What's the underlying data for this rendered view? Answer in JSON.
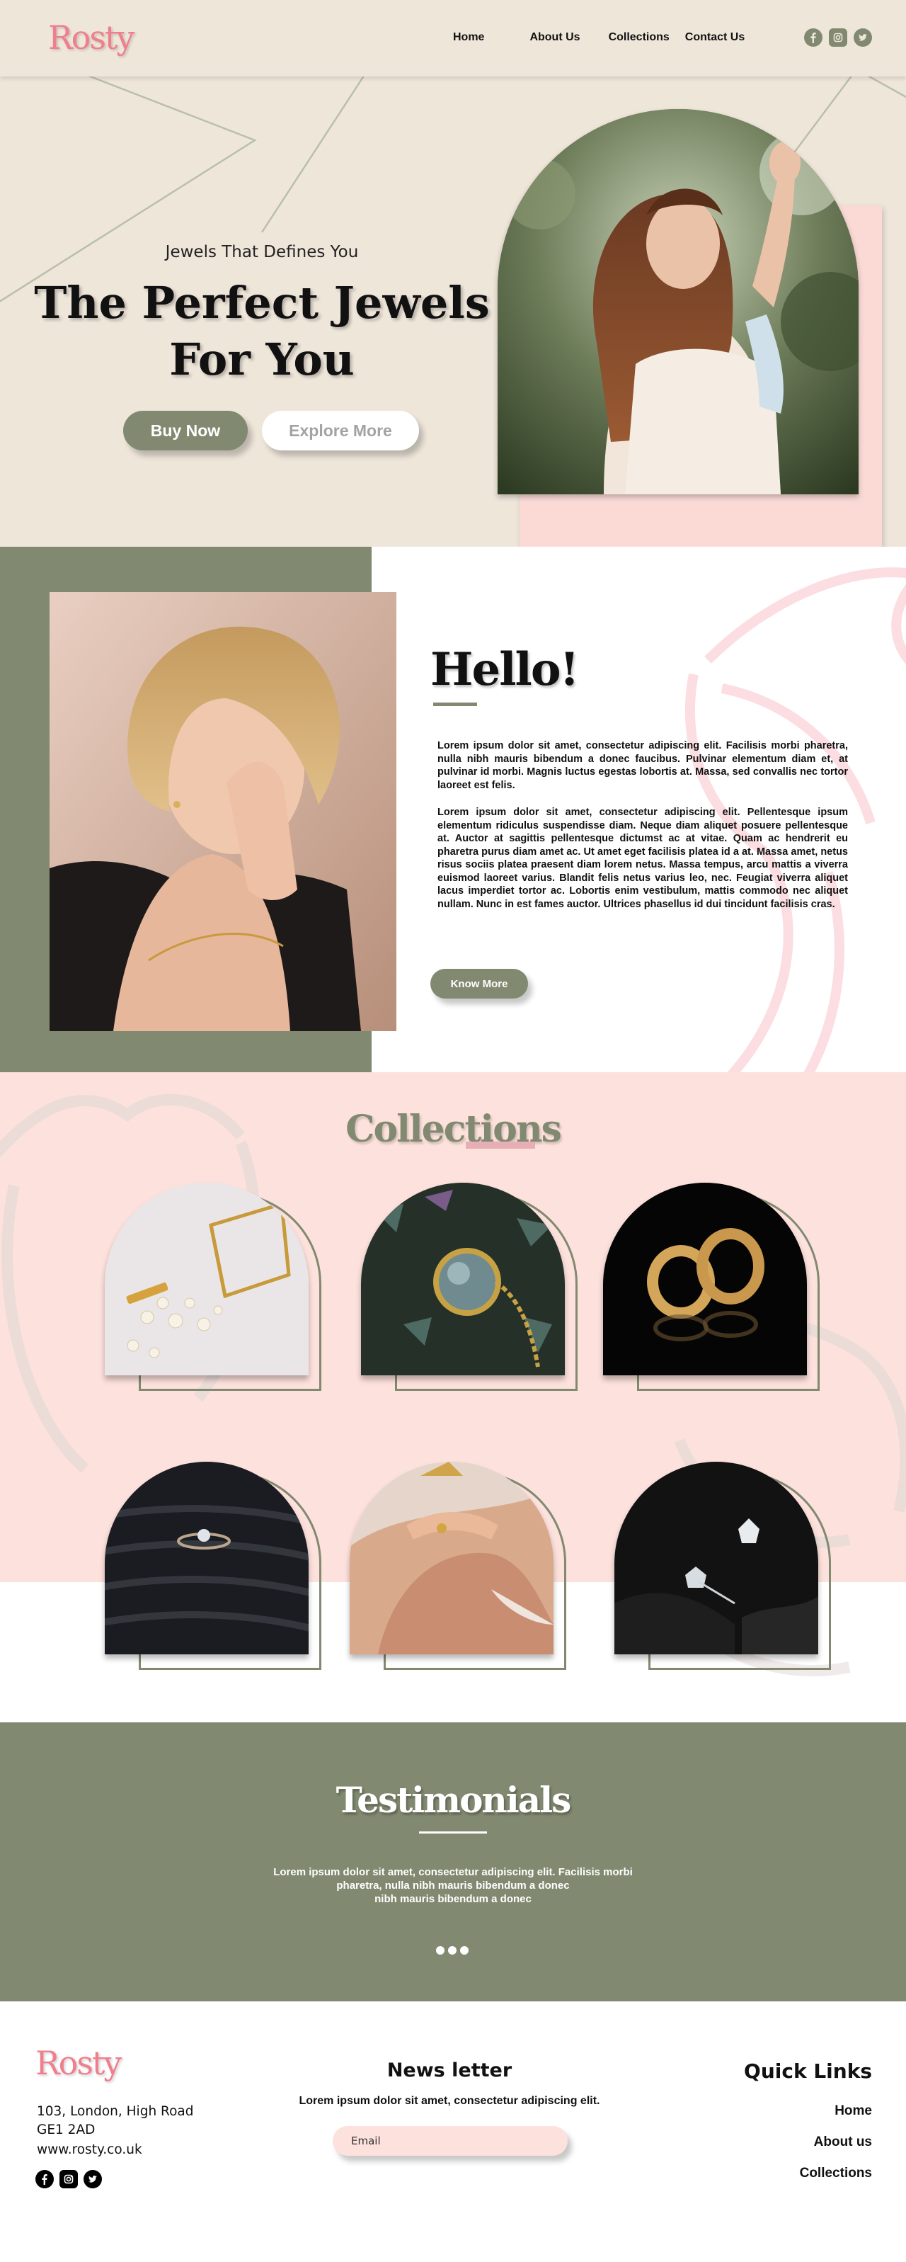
{
  "brand": {
    "name": "Rosty",
    "color": "#ef7f8c"
  },
  "colors": {
    "sage": "#818a70",
    "cream": "#efe6da",
    "blush": "#fde1dc",
    "white": "#ffffff"
  },
  "nav": {
    "links": [
      "Home",
      "About Us",
      "Collections",
      "Contact Us"
    ],
    "social_icons": [
      "facebook-icon",
      "instagram-icon",
      "twitter-icon"
    ]
  },
  "hero": {
    "tagline": "Jewels That Defines You",
    "title_line1": "The Perfect Jewels",
    "title_line2": "For You",
    "buy_label": "Buy Now",
    "explore_label": "Explore More"
  },
  "hello": {
    "title": "Hello!",
    "paragraph1": "Lorem ipsum dolor sit amet, consectetur adipiscing elit. Facilisis morbi pharetra, nulla nibh mauris bibendum a donec faucibus. Pulvinar elementum diam et, at pulvinar id morbi. Magnis luctus egestas lobortis at. Massa, sed convallis nec tortor laoreet est felis.",
    "paragraph2": "Lorem ipsum dolor sit amet, consectetur adipiscing elit. Pellentesque ipsum elementum ridiculus suspendisse diam. Neque diam aliquet posuere pellentesque at. Auctor at sagittis pellentesque dictumst ac at vitae. Quam ac hendrerit eu pharetra purus diam amet ac. Ut amet eget facilisis platea id a at. Massa amet, netus risus sociis platea praesent diam lorem netus. Massa tempus, arcu mattis a viverra euismod laoreet varius. Blandit felis netus varius leo, nec. Feugiat viverra aliquet lacus imperdiet tortor ac. Lobortis enim vestibulum, mattis commodo nec aliquet nullam. Nunc in est fames auctor. Ultrices phasellus id dui tincidunt facilisis cras.",
    "button_label": "Know More"
  },
  "collections": {
    "title": "Collections",
    "items": [
      {
        "name": "jewelry-box-and-hairpin"
      },
      {
        "name": "moonstone-pendant"
      },
      {
        "name": "gold-hoop-earrings"
      },
      {
        "name": "diamond-ring"
      },
      {
        "name": "gold-rings-on-hand"
      },
      {
        "name": "diamond-stud-earrings"
      }
    ]
  },
  "testimonials": {
    "title": "Testimonials",
    "text_line1": "Lorem ipsum dolor sit amet, consectetur adipiscing elit. Facilisis morbi",
    "text_line2": "pharetra, nulla nibh mauris bibendum a donec",
    "text_line3": "nibh mauris bibendum a donec",
    "dots": 3
  },
  "footer": {
    "logo": "Rosty",
    "address_line1": "103, London, High Road",
    "address_line2": "GE1 2AD",
    "website": "www.rosty.co.uk",
    "social_icons": [
      "facebook-icon",
      "instagram-icon",
      "twitter-icon"
    ],
    "newsletter": {
      "title": "News letter",
      "subtitle": "Lorem ipsum dolor sit amet, consectetur adipiscing elit.",
      "placeholder": "Email"
    },
    "quick_links": {
      "title": "Quick Links",
      "links": [
        "Home",
        "About us",
        "Collections"
      ]
    }
  }
}
